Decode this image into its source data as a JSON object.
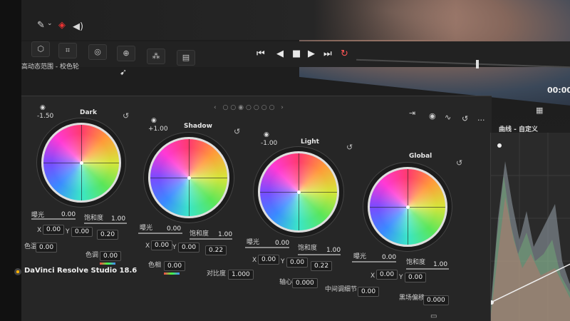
{
  "toolbar": {
    "eyedropper_icon": "eyedropper-icon",
    "layers_icon": "layers-icon",
    "audio_icon": "speaker-icon"
  },
  "subheader": {
    "title": "高动态范围 - 校色轮"
  },
  "timecode": "00:00",
  "wheels": [
    {
      "title": "Dark",
      "knob": "-1.50",
      "exposure_label": "曝光",
      "exposure": "0.00",
      "sat_label": "饱和度",
      "sat": "1.00",
      "x": "0.00",
      "y": "0.00",
      "z": "0.20"
    },
    {
      "title": "Shadow",
      "knob": "+1.00",
      "exposure_label": "曝光",
      "exposure": "0.00",
      "sat_label": "饱和度",
      "sat": "1.00",
      "x": "0.00",
      "y": "0.00",
      "z": "0.22"
    },
    {
      "title": "Light",
      "knob": "-1.00",
      "exposure_label": "曝光",
      "exposure": "0.00",
      "sat_label": "饱和度",
      "sat": "1.00",
      "x": "0.00",
      "y": "0.00",
      "z": "0.22"
    },
    {
      "title": "Global",
      "knob": "",
      "exposure_label": "曝光",
      "exposure": "0.00",
      "sat_label": "饱和度",
      "sat": "1.00",
      "x": "0.00",
      "y": "0.00",
      "z": ""
    }
  ],
  "bottom": {
    "color_temp_label": "色温",
    "color_temp": "0.00",
    "tint_label": "色调",
    "tint": "0.00",
    "hue_label": "色相",
    "hue": "0.00",
    "contrast_label": "对比度",
    "contrast": "1.000",
    "pivot_label": "轴心",
    "pivot": "0.000",
    "midtone_label": "中间调细节",
    "midtone": "0.00",
    "black_label": "黑场偏移",
    "black": "0.000"
  },
  "curves": {
    "title": "曲线 - 自定义"
  },
  "branding": {
    "app_name": "DaVinci Resolve Studio 18.6"
  },
  "axis_letters": {
    "x": "X",
    "y": "Y"
  }
}
